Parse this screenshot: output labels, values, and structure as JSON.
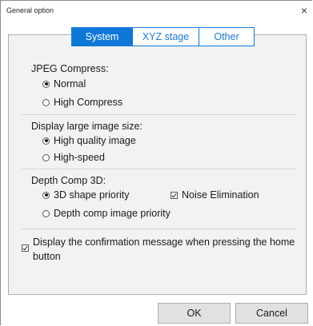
{
  "window": {
    "title": "General option",
    "close_glyph": "×"
  },
  "tabs": [
    {
      "label": "System",
      "active": true
    },
    {
      "label": "XYZ stage",
      "active": false
    },
    {
      "label": "Other",
      "active": false
    }
  ],
  "jpeg": {
    "label": "JPEG Compress:",
    "options": [
      {
        "label": "Normal",
        "checked": true
      },
      {
        "label": "High Compress",
        "checked": false
      }
    ]
  },
  "display": {
    "label": "Display large image size:",
    "options": [
      {
        "label": "High quality image",
        "checked": true
      },
      {
        "label": "High-speed",
        "checked": false
      }
    ]
  },
  "depth": {
    "label": "Depth Comp 3D:",
    "options": [
      {
        "label": "3D shape priority",
        "checked": true
      },
      {
        "label": "Depth comp image priority",
        "checked": false
      }
    ],
    "noise": {
      "label": "Noise Elimination",
      "checked": true
    }
  },
  "confirm": {
    "label": "Display the confirmation message when pressing the home button",
    "checked": true
  },
  "buttons": {
    "ok": "OK",
    "cancel": "Cancel"
  },
  "colors": {
    "tab_accent": "#0f78d7"
  }
}
